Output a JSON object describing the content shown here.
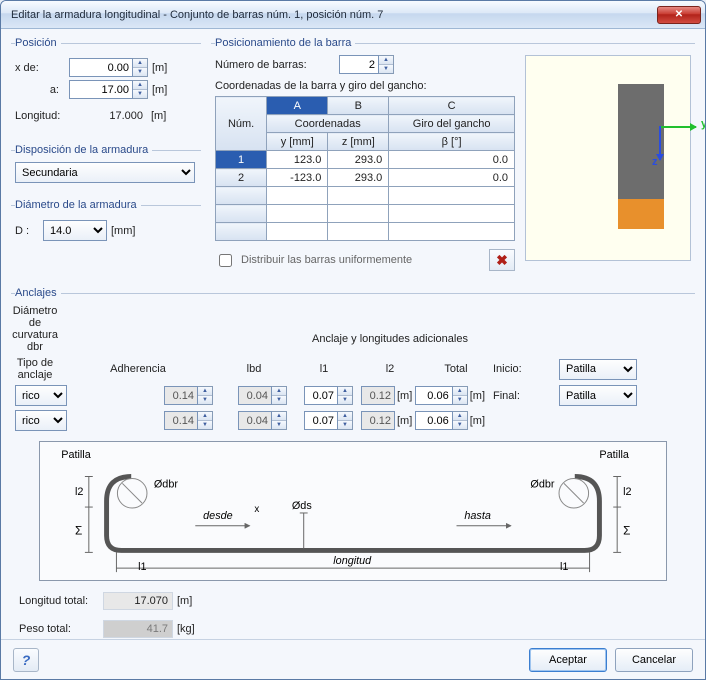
{
  "window": {
    "title": "Editar la armadura longitudinal - Conjunto de barras núm. 1, posición núm. 7",
    "close_icon": "✕"
  },
  "posicion": {
    "legend": "Posición",
    "x_de_label": "x  de:",
    "a_label": "a:",
    "longitud_label": "Longitud:",
    "x_de_value": "0.00",
    "a_value": "17.00",
    "longitud_value": "17.000",
    "unit": "[m]"
  },
  "disposicion": {
    "legend": "Disposición de la armadura",
    "value": "Secundaria"
  },
  "diametro": {
    "legend": "Diámetro de la armadura",
    "label": "D :",
    "value": "14.0",
    "unit": "[mm]"
  },
  "pos_barra": {
    "legend": "Posicionamiento de la barra",
    "num_label": "Número de barras:",
    "num_value": "2",
    "coord_label": "Coordenadas de la barra y giro del gancho:",
    "headers": {
      "num": "Núm.",
      "A": "A",
      "B": "B",
      "C": "C",
      "coord": "Coordenadas",
      "giro": "Giro del gancho",
      "y": "y [mm]",
      "z": "z [mm]",
      "beta": "β [°]"
    },
    "rows": [
      {
        "idx": "1",
        "y": "123.0",
        "z": "293.0",
        "beta": "0.0",
        "selected": true
      },
      {
        "idx": "2",
        "y": "-123.0",
        "z": "293.0",
        "beta": "0.0",
        "selected": false
      }
    ],
    "distrib_label": "Distribuir las barras uniformemente",
    "distrib_checked": false,
    "xbtn_label": "✖",
    "axis_y_label": "y",
    "axis_z_label": "z"
  },
  "anclajes": {
    "legend": "Anclajes",
    "hdr_tipo": "Tipo de anclaje",
    "hdr_adh": "Adherencia",
    "hdr_anc_long": "Anclaje y longitudes adicionales",
    "hdr_lbd": "lbd",
    "hdr_l1": "l1",
    "hdr_l2": "l2",
    "hdr_total": "Total",
    "hdr_dbr": "Diámetro de curvatura dbr",
    "row_inicio": "Inicio:",
    "row_final": "Final:",
    "tipo_inicio": "Patilla",
    "tipo_final": "Patilla",
    "adh_inicio": "rico",
    "adh_final": "rico",
    "lbd_inicio": "0.14",
    "l1_inicio": "0.04",
    "l2_inicio": "0.07",
    "total_inicio": "0.12",
    "dbr_inicio": "0.06",
    "lbd_final": "0.14",
    "l1_final": "0.04",
    "l2_final": "0.07",
    "total_final": "0.12",
    "dbr_final": "0.06",
    "unit": "[m]"
  },
  "diagram": {
    "patilla_left": "Patilla",
    "patilla_right": "Patilla",
    "desde": "desde",
    "hasta": "hasta",
    "longitud": "longitud",
    "odbr": "Ødbr",
    "ods": "Øds",
    "l1": "l1",
    "l2": "l2",
    "sigma": "Σ",
    "x": "x"
  },
  "totals": {
    "longitud_label": "Longitud total:",
    "longitud_value": "17.070",
    "longitud_unit": "[m]",
    "peso_label": "Peso total:",
    "peso_value": "41.7",
    "peso_unit": "[kg]"
  },
  "footer": {
    "help": "?",
    "accept": "Aceptar",
    "cancel": "Cancelar"
  }
}
